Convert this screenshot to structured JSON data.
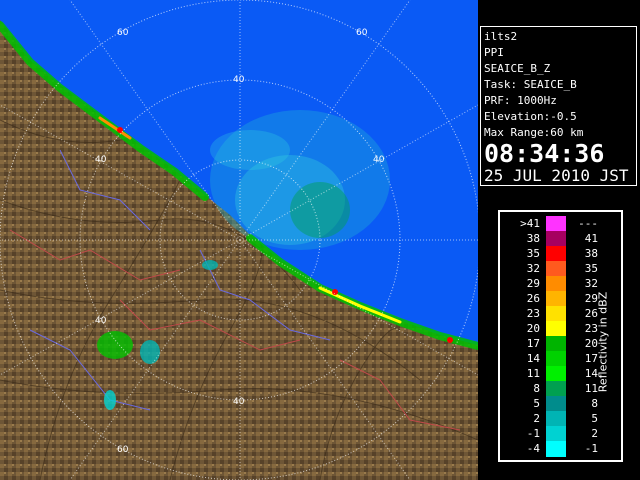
{
  "radar_info": {
    "site": "ilts2",
    "product": "PPI",
    "field": "SEAICE_B_Z",
    "task": "Task: SEAICE_B",
    "prf": "PRF: 1000Hz",
    "elevation": "Elevation:-0.5",
    "max_range": "Max Range:60 km",
    "time": "08:34:36",
    "date": "25 JUL 2010 JST"
  },
  "range_labels": [
    {
      "text": "60"
    },
    {
      "text": "40"
    },
    {
      "text": "60"
    },
    {
      "text": "40"
    },
    {
      "text": "40"
    },
    {
      "text": "40"
    },
    {
      "text": "40"
    },
    {
      "text": "60"
    }
  ],
  "legend": {
    "unit": "Reflectivity in dBZ",
    "rows": [
      {
        "lo": ">41",
        "hi": "---",
        "color": "#ff33ff"
      },
      {
        "lo": "38",
        "hi": "41",
        "color": "#a60060"
      },
      {
        "lo": "35",
        "hi": "38",
        "color": "#ff0000"
      },
      {
        "lo": "32",
        "hi": "35",
        "color": "#ff5a1e"
      },
      {
        "lo": "29",
        "hi": "32",
        "color": "#ff8c00"
      },
      {
        "lo": "26",
        "hi": "29",
        "color": "#ffb400"
      },
      {
        "lo": "23",
        "hi": "26",
        "color": "#ffe100"
      },
      {
        "lo": "20",
        "hi": "23",
        "color": "#ffff00"
      },
      {
        "lo": "17",
        "hi": "20",
        "color": "#00b400"
      },
      {
        "lo": "14",
        "hi": "17",
        "color": "#00d200"
      },
      {
        "lo": "11",
        "hi": "14",
        "color": "#00f000"
      },
      {
        "lo": "8",
        "hi": "11",
        "color": "#00a050"
      },
      {
        "lo": "5",
        "hi": "8",
        "color": "#008c8c"
      },
      {
        "lo": "2",
        "hi": "5",
        "color": "#00b4b4"
      },
      {
        "lo": "-1",
        "hi": "2",
        "color": "#00d2d2"
      },
      {
        "lo": "-4",
        "hi": "-1",
        "color": "#00ffff"
      }
    ]
  }
}
